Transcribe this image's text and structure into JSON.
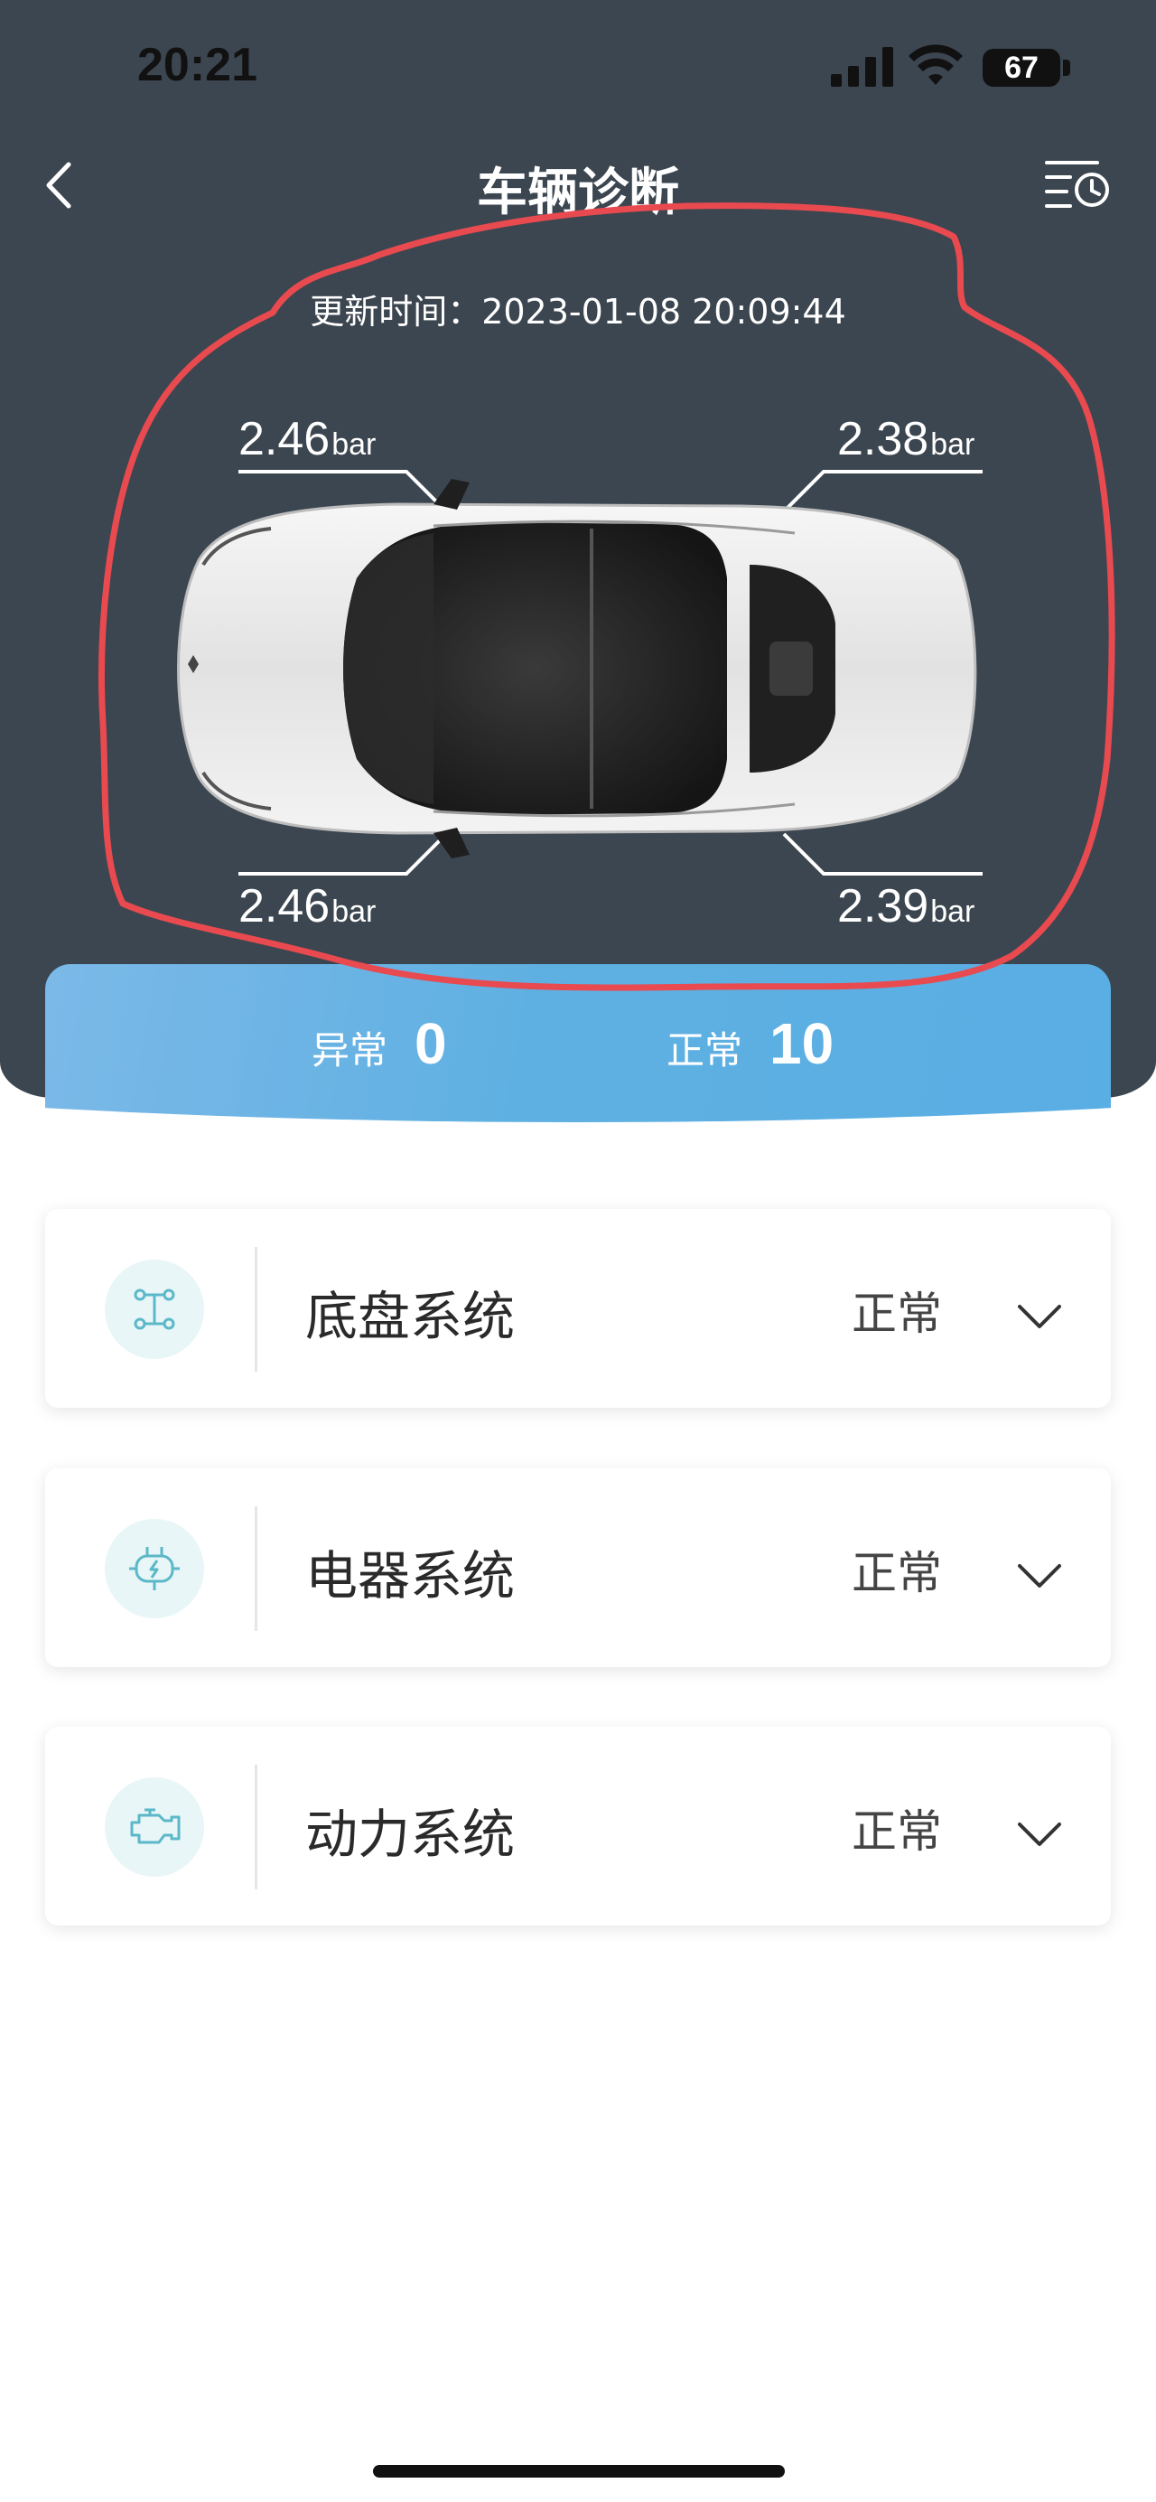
{
  "status_bar": {
    "time": "20:21",
    "battery": "67"
  },
  "nav": {
    "title": "车辆诊断",
    "back_icon": "chevron-left-icon",
    "history_icon": "history-list-icon"
  },
  "update_time": "更新时间：2023-01-08 20:09:44",
  "tires": {
    "front_left": {
      "value": "2.46",
      "unit": "bar"
    },
    "front_right": {
      "value": "2.38",
      "unit": "bar"
    },
    "rear_left": {
      "value": "2.46",
      "unit": "bar"
    },
    "rear_right": {
      "value": "2.39",
      "unit": "bar"
    }
  },
  "summary": {
    "abnormal_label": "异常",
    "abnormal_count": "0",
    "normal_label": "正常",
    "normal_count": "10"
  },
  "systems": [
    {
      "name": "底盘系统",
      "status": "正常",
      "icon": "chassis-icon"
    },
    {
      "name": "电器系统",
      "status": "正常",
      "icon": "electrical-plug-icon"
    },
    {
      "name": "动力系统",
      "status": "正常",
      "icon": "engine-icon"
    }
  ],
  "colors": {
    "header_bg": "#3c4650",
    "summary_bg": "#5fb0e2",
    "icon_accent": "#5bb8c8",
    "annotation": "#e84a4f"
  }
}
